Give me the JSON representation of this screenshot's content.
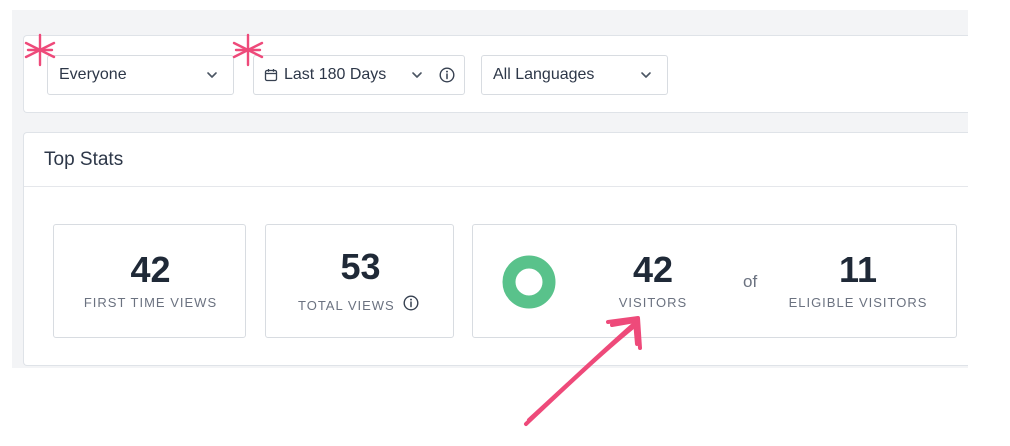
{
  "filters": {
    "audience": {
      "label": "Everyone"
    },
    "date_range": {
      "label": "Last 180 Days"
    },
    "language": {
      "label": "All Languages"
    }
  },
  "top_stats": {
    "title": "Top Stats",
    "first_time_views": {
      "value": "42",
      "label": "FIRST TIME VIEWS"
    },
    "total_views": {
      "value": "53",
      "label": "TOTAL VIEWS"
    },
    "visitors": {
      "value": "42",
      "label": "VISITORS",
      "of_text": "of",
      "eligible_value": "11",
      "eligible_label": "ELIGIBLE VISITORS"
    }
  },
  "icons": {
    "chevron": "chevron-down-icon",
    "calendar": "calendar-icon",
    "info": "info-icon",
    "donut": "donut-chart-icon"
  },
  "colors": {
    "donut_green": "#59c28b",
    "annotation_pink": "#ee4a7a",
    "text_dark": "#1f2937",
    "text_muted": "#6b7280"
  }
}
